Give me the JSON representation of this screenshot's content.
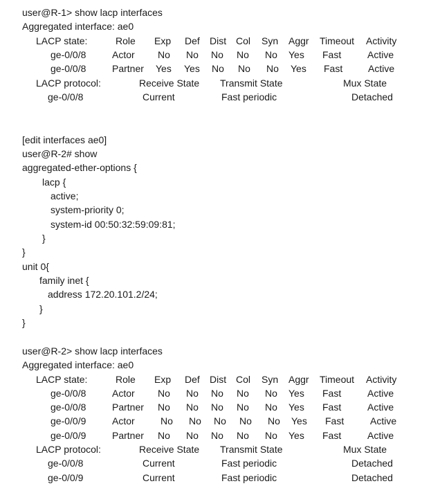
{
  "r1": {
    "prompt": "user@R-1> show lacp interfaces",
    "agg": "Aggregated interface: ae0",
    "state_header": [
      "LACP state:",
      "Role",
      "Exp",
      "Def",
      "Dist",
      "Col",
      "Syn",
      "Aggr",
      "Timeout",
      "Activity"
    ],
    "state_rows": [
      [
        "ge-0/0/8",
        "Actor",
        "No",
        "No",
        "No",
        "No",
        "No",
        "Yes",
        "Fast",
        "Active"
      ],
      [
        "ge-0/0/8",
        "Partner",
        "Yes",
        "Yes",
        "No",
        "No",
        "No",
        "Yes",
        "Fast",
        "Active"
      ]
    ],
    "proto_header": [
      "LACP protocol:",
      "Receive State",
      "Transmit State",
      "Mux State"
    ],
    "proto_rows": [
      [
        "ge-0/0/8",
        "Current",
        "Fast periodic",
        "Detached"
      ]
    ]
  },
  "config": {
    "lines": [
      "[edit interfaces ae0]",
      "user@R-2# show",
      "aggregated-ether-options {",
      "lacp {",
      "active;",
      "system-priority 0;",
      "system-id 00:50:32:59:09:81;",
      "}",
      "}",
      "unit 0{",
      "family inet {",
      "address 172.20.101.2/24;",
      "}",
      "}"
    ]
  },
  "r2": {
    "prompt": "user@R-2> show lacp interfaces",
    "agg": "Aggregated interface: ae0",
    "state_header": [
      "LACP state:",
      "Role",
      "Exp",
      "Def",
      "Dist",
      "Col",
      "Syn",
      "Aggr",
      "Timeout",
      "Activity"
    ],
    "state_rows": [
      [
        "ge-0/0/8",
        "Actor",
        "No",
        "No",
        "No",
        "No",
        "No",
        "Yes",
        "Fast",
        "Active"
      ],
      [
        "ge-0/0/8",
        "Partner",
        "No",
        "No",
        "No",
        "No",
        "No",
        "Yes",
        "Fast",
        "Active"
      ],
      [
        "ge-0/0/9",
        "Actor",
        "No",
        "No",
        "No",
        "No",
        "No",
        "Yes",
        "Fast",
        "Active"
      ],
      [
        "ge-0/0/9",
        "Partner",
        "No",
        "No",
        "No",
        "No",
        "No",
        "Yes",
        "Fast",
        "Active"
      ]
    ],
    "proto_header": [
      "LACP protocol:",
      "Receive State",
      "Transmit State",
      "Mux State"
    ],
    "proto_rows": [
      [
        "ge-0/0/8",
        "Current",
        "Fast periodic",
        "Detached"
      ],
      [
        "ge-0/0/9",
        "Current",
        "Fast periodic",
        "Detached"
      ]
    ]
  }
}
